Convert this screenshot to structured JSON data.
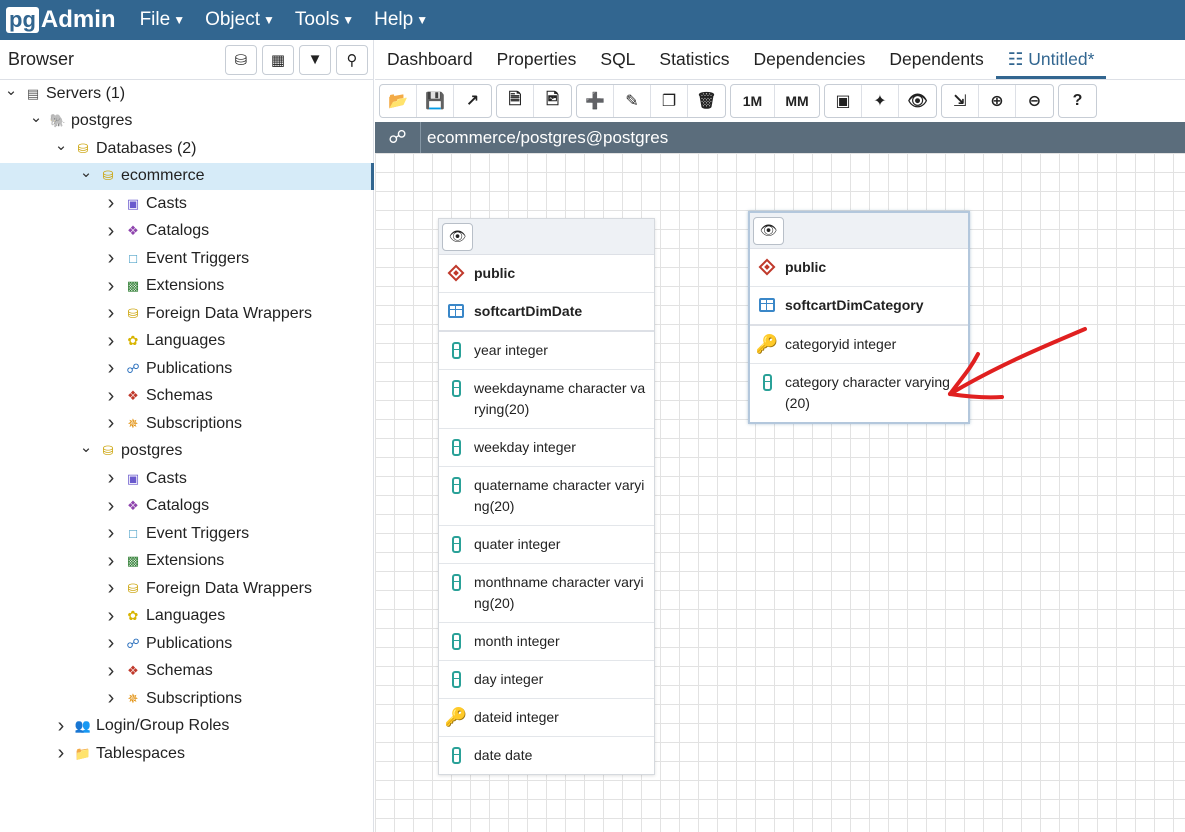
{
  "app": {
    "logo_pg": "pg",
    "logo_admin": "Admin"
  },
  "menus": [
    "File",
    "Object",
    "Tools",
    "Help"
  ],
  "browser": {
    "title": "Browser",
    "tree": [
      {
        "label": "Servers (1)",
        "level": 0,
        "chev": "v",
        "icon": "servers-icon"
      },
      {
        "label": "postgres",
        "level": 1,
        "chev": "v",
        "icon": "elephant-icon"
      },
      {
        "label": "Databases (2)",
        "level": 2,
        "chev": "v",
        "icon": "databases-icon"
      },
      {
        "label": "ecommerce",
        "level": 3,
        "chev": "v",
        "icon": "database-icon",
        "selected": true
      },
      {
        "label": "Casts",
        "level": 4,
        "chev": ">",
        "icon": "casts-icon"
      },
      {
        "label": "Catalogs",
        "level": 4,
        "chev": ">",
        "icon": "catalogs-icon"
      },
      {
        "label": "Event Triggers",
        "level": 4,
        "chev": ">",
        "icon": "event-triggers-icon"
      },
      {
        "label": "Extensions",
        "level": 4,
        "chev": ">",
        "icon": "extensions-icon"
      },
      {
        "label": "Foreign Data Wrappers",
        "level": 4,
        "chev": ">",
        "icon": "fdw-icon"
      },
      {
        "label": "Languages",
        "level": 4,
        "chev": ">",
        "icon": "languages-icon"
      },
      {
        "label": "Publications",
        "level": 4,
        "chev": ">",
        "icon": "publications-icon"
      },
      {
        "label": "Schemas",
        "level": 4,
        "chev": ">",
        "icon": "schemas-icon"
      },
      {
        "label": "Subscriptions",
        "level": 4,
        "chev": ">",
        "icon": "subscriptions-icon"
      },
      {
        "label": "postgres",
        "level": 3,
        "chev": "v",
        "icon": "database-icon"
      },
      {
        "label": "Casts",
        "level": 4,
        "chev": ">",
        "icon": "casts-icon"
      },
      {
        "label": "Catalogs",
        "level": 4,
        "chev": ">",
        "icon": "catalogs-icon"
      },
      {
        "label": "Event Triggers",
        "level": 4,
        "chev": ">",
        "icon": "event-triggers-icon"
      },
      {
        "label": "Extensions",
        "level": 4,
        "chev": ">",
        "icon": "extensions-icon"
      },
      {
        "label": "Foreign Data Wrappers",
        "level": 4,
        "chev": ">",
        "icon": "fdw-icon"
      },
      {
        "label": "Languages",
        "level": 4,
        "chev": ">",
        "icon": "languages-icon"
      },
      {
        "label": "Publications",
        "level": 4,
        "chev": ">",
        "icon": "publications-icon"
      },
      {
        "label": "Schemas",
        "level": 4,
        "chev": ">",
        "icon": "schemas-icon"
      },
      {
        "label": "Subscriptions",
        "level": 4,
        "chev": ">",
        "icon": "subscriptions-icon"
      },
      {
        "label": "Login/Group Roles",
        "level": 2,
        "chev": ">",
        "icon": "roles-icon"
      },
      {
        "label": "Tablespaces",
        "level": 2,
        "chev": ">",
        "icon": "tablespaces-icon"
      }
    ]
  },
  "tabs": [
    {
      "label": "Dashboard"
    },
    {
      "label": "Properties"
    },
    {
      "label": "SQL"
    },
    {
      "label": "Statistics"
    },
    {
      "label": "Dependencies"
    },
    {
      "label": "Dependents"
    },
    {
      "label": "Untitled*",
      "active": true
    }
  ],
  "toolbar": {
    "one_to_many": "1M",
    "many_to_many": "MM"
  },
  "connection": {
    "label": "ecommerce/postgres@postgres"
  },
  "erd_tables": [
    {
      "schema": "public",
      "name": "softcartDimDate",
      "columns": [
        {
          "text": "year integer",
          "icon": "column"
        },
        {
          "text": "weekdayname character varying(20)",
          "icon": "column"
        },
        {
          "text": "weekday integer",
          "icon": "column"
        },
        {
          "text": "quatername character varying(20)",
          "icon": "column"
        },
        {
          "text": "quater integer",
          "icon": "column"
        },
        {
          "text": "monthname character varying(20)",
          "icon": "column"
        },
        {
          "text": "month integer",
          "icon": "column"
        },
        {
          "text": "day integer",
          "icon": "column"
        },
        {
          "text": "dateid integer",
          "icon": "key"
        },
        {
          "text": "date date",
          "icon": "column"
        }
      ]
    },
    {
      "schema": "public",
      "name": "softcartDimCategory",
      "selected": true,
      "columns": [
        {
          "text": "categoryid integer",
          "icon": "key"
        },
        {
          "text": "category character varying (20)",
          "icon": "column"
        }
      ]
    }
  ],
  "colors": {
    "brand": "#326690",
    "annotation_arrow": "#e02020"
  }
}
